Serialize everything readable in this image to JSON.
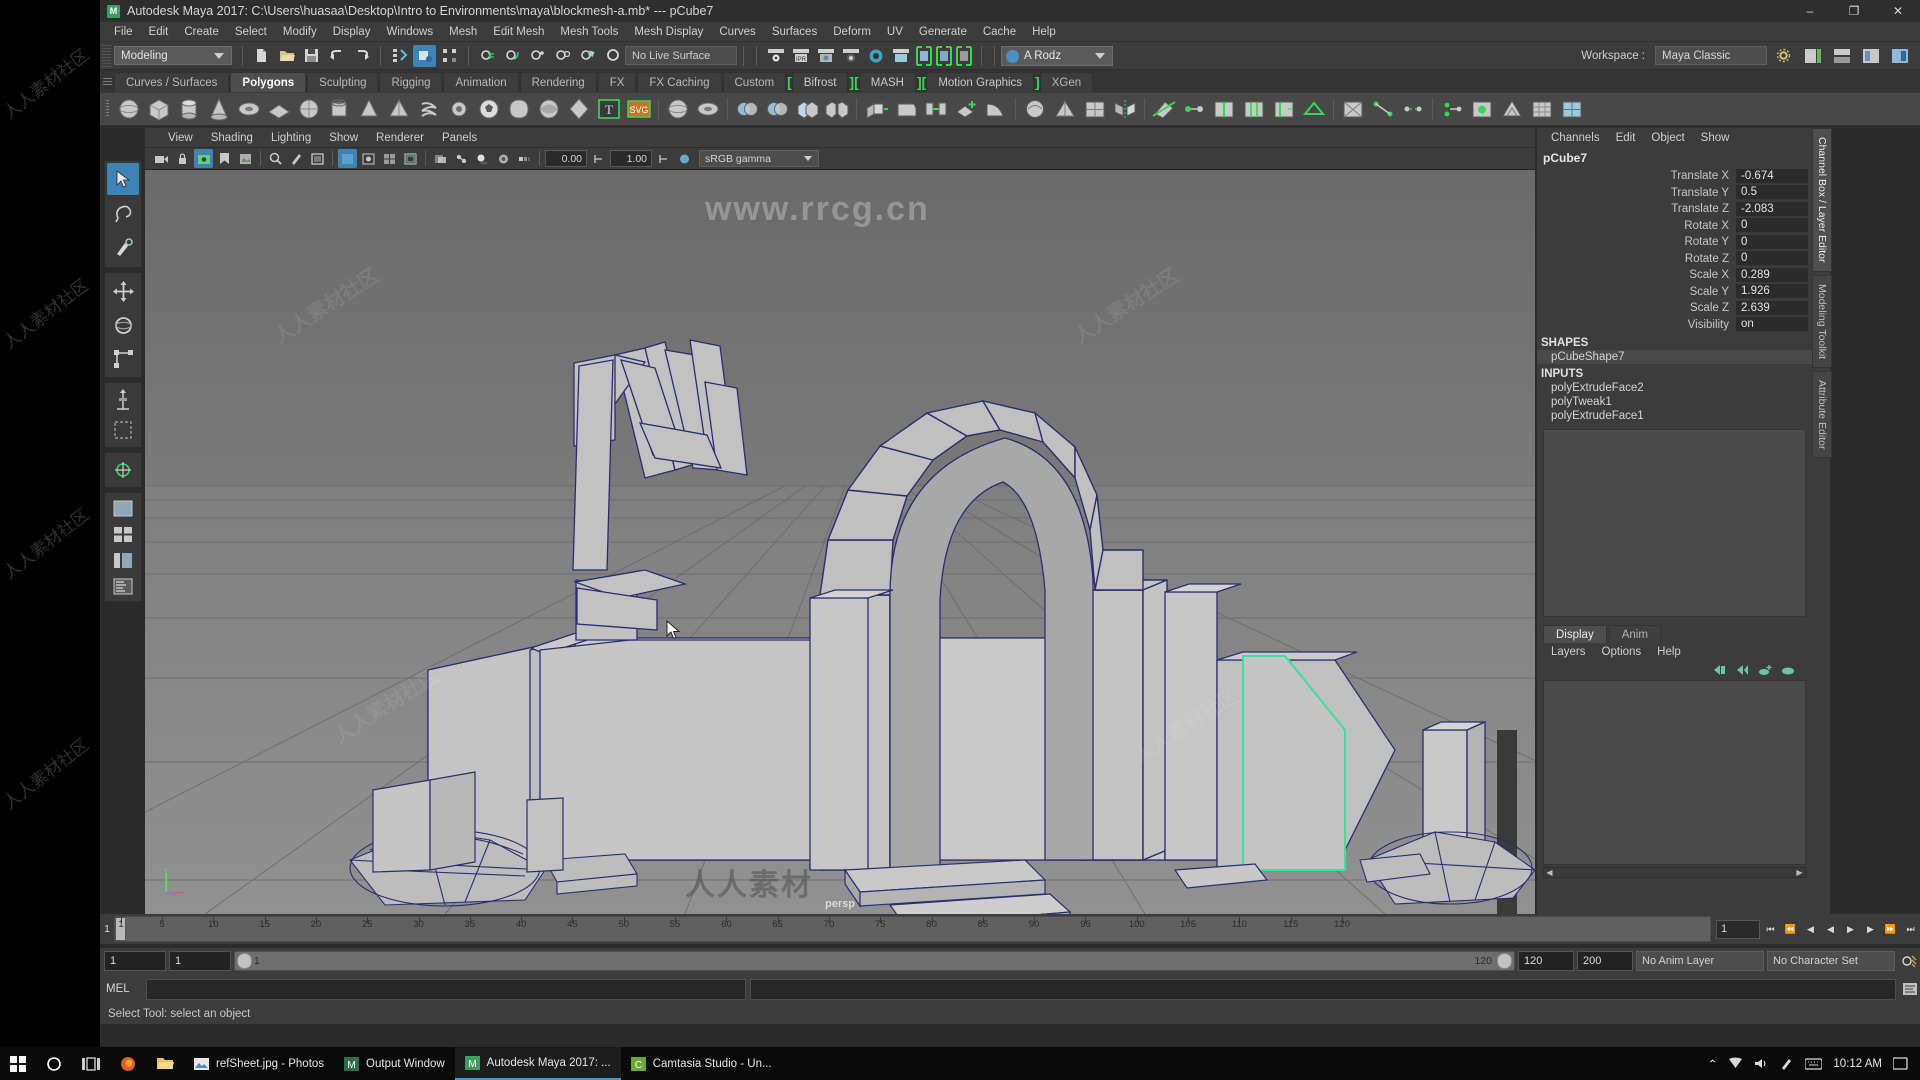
{
  "window": {
    "app_icon": "maya-logo-icon",
    "title": "Autodesk Maya 2017: C:\\Users\\huasaa\\Desktop\\Intro to Environments\\maya\\blockmesh-a.mb*  ---  pCube7",
    "minimize": "–",
    "maximize": "❐",
    "close": "✕"
  },
  "menubar": {
    "items": [
      "File",
      "Edit",
      "Create",
      "Select",
      "Modify",
      "Display",
      "Windows",
      "Mesh",
      "Edit Mesh",
      "Mesh Tools",
      "Mesh Display",
      "Curves",
      "Surfaces",
      "Deform",
      "UV",
      "Generate",
      "Cache",
      "Help"
    ]
  },
  "statusbar": {
    "mode": "Modeling",
    "live_surface": "No Live Surface",
    "num_a": "0.00",
    "num_b": "1.00",
    "gamma": "sRGB gamma",
    "user": "A Rodz",
    "workspace_label": "Workspace :",
    "workspace_value": "Maya Classic",
    "icons": [
      "new-scene-icon",
      "open-scene-icon",
      "save-scene-icon",
      "undo-icon",
      "redo-icon",
      "select-by-hierarchy-icon",
      "select-by-object-icon",
      "select-by-component-icon",
      "snap-to-grid-icon",
      "snap-to-curve-icon",
      "snap-to-point-icon",
      "snap-to-projected-center-icon",
      "snap-to-view-plane-icon",
      "make-live-icon",
      "render-current-frame-icon",
      "ipr-render-icon",
      "render-settings-icon",
      "hypershade-icon",
      "render-view-icon",
      "toggle-ui-icon"
    ]
  },
  "shelf": {
    "tabs": [
      "Curves / Surfaces",
      "Polygons",
      "Sculpting",
      "Rigging",
      "Animation",
      "Rendering",
      "FX",
      "FX Caching",
      "Custom",
      "Bifrost",
      "MASH",
      "Motion Graphics",
      "XGen"
    ],
    "active_tab": "Polygons",
    "bracketed_tabs": [
      "Bifrost",
      "MASH",
      "Motion Graphics"
    ],
    "icons": [
      "poly-sphere-icon",
      "poly-cube-icon",
      "poly-cylinder-icon",
      "poly-cone-icon",
      "poly-torus-icon",
      "poly-plane-icon",
      "poly-disc-icon",
      "poly-pipe-icon",
      "poly-prism-icon",
      "poly-pyramid-icon",
      "poly-helix-icon",
      "poly-gear-icon",
      "poly-soccer-ball-icon",
      "poly-super-ellipse-icon",
      "poly-spherical-harmonics-icon",
      "poly-ultra-shape-icon",
      "type-tool-icon",
      "svg-tool-icon",
      "sculpt-sphere-icon",
      "sculpt-torus-icon",
      "boolean-union-icon",
      "boolean-difference-icon",
      "combine-icon",
      "separate-icon",
      "extrude-icon",
      "bevel-icon",
      "bridge-icon",
      "append-polygon-icon",
      "wedge-face-icon",
      "smooth-icon",
      "triangulate-icon",
      "quadrangulate-icon",
      "mirror-geometry-icon",
      "multi-cut-icon",
      "target-weld-icon",
      "insert-edge-loop-icon",
      "offset-edge-loop-icon",
      "slide-edge-icon",
      "crease-tool-icon",
      "poke-face-icon",
      "connect-components-icon",
      "detach-component-icon",
      "merge-vertices-icon",
      "fill-hole-icon",
      "reduce-icon",
      "remesh-icon",
      "retopologize-icon"
    ]
  },
  "viewport": {
    "menus": [
      "View",
      "Shading",
      "Lighting",
      "Show",
      "Renderer",
      "Panels"
    ],
    "camera_label": "persp",
    "exposure": "0.00",
    "contrast": "1.00",
    "gamma": "sRGB gamma",
    "toolbar_icons": [
      "select-camera-icon",
      "lock-camera-icon",
      "camera-attributes-icon",
      "bookmark-icon",
      "image-plane-icon",
      "two-d-pan-zoom-icon",
      "grease-pencil-icon",
      "gate-mask-icon",
      "resolution-gate-icon",
      "film-gate-icon",
      "field-chart-icon",
      "safe-action-icon",
      "safe-title-icon",
      "xray-icon",
      "xray-joints-icon",
      "shadows-icon",
      "screen-space-ao-icon",
      "motion-blur-icon",
      "multisample-icon",
      "depth-of-field-icon",
      "color-management-icon"
    ]
  },
  "channelbox": {
    "menus": [
      "Channels",
      "Edit",
      "Object",
      "Show"
    ],
    "object_name": "pCube7",
    "attributes": [
      {
        "label": "Translate X",
        "value": "-0.674"
      },
      {
        "label": "Translate Y",
        "value": "0.5"
      },
      {
        "label": "Translate Z",
        "value": "-2.083"
      },
      {
        "label": "Rotate X",
        "value": "0"
      },
      {
        "label": "Rotate Y",
        "value": "0"
      },
      {
        "label": "Rotate Z",
        "value": "0"
      },
      {
        "label": "Scale X",
        "value": "0.289"
      },
      {
        "label": "Scale Y",
        "value": "1.926"
      },
      {
        "label": "Scale Z",
        "value": "2.639"
      },
      {
        "label": "Visibility",
        "value": "on"
      }
    ],
    "shapes_header": "SHAPES",
    "shapes": [
      "pCubeShape7"
    ],
    "inputs_header": "INPUTS",
    "inputs": [
      "polyExtrudeFace2",
      "polyTweak1",
      "polyExtrudeFace1"
    ]
  },
  "layer_editor": {
    "tabs": [
      "Display",
      "Anim"
    ],
    "active_tab": "Display",
    "menus": [
      "Layers",
      "Options",
      "Help"
    ],
    "buttons": [
      "new-layer-icon",
      "new-layer-from-selected-icon",
      "add-selected-icon",
      "remove-selected-icon"
    ]
  },
  "right_vtabs": {
    "items": [
      "Channel Box / Layer Editor",
      "Modeling Toolkit",
      "Attribute Editor"
    ],
    "active": "Channel Box / Layer Editor"
  },
  "timeline": {
    "ticks": [
      1,
      5,
      10,
      15,
      20,
      25,
      30,
      35,
      40,
      45,
      50,
      55,
      60,
      65,
      70,
      75,
      80,
      85,
      90,
      95,
      100,
      105,
      110,
      115,
      120
    ],
    "current_frame": "1",
    "playhead_frame": "1",
    "frame_field": "1",
    "transport_icons": [
      "go-to-start-icon",
      "step-back-key-icon",
      "step-back-frame-icon",
      "play-backwards-icon",
      "play-forwards-icon",
      "step-forward-frame-icon",
      "step-forward-key-icon",
      "go-to-end-icon"
    ]
  },
  "range": {
    "start": "1",
    "current": "1",
    "slider_min": "1",
    "slider_max": "120",
    "range_end": "120",
    "playback_end": "200",
    "anim_layer": "No Anim Layer",
    "character_set": "No Character Set",
    "anim_preferences_icon": "animation-preferences-icon"
  },
  "command_line": {
    "label": "MEL",
    "input_value": "",
    "output_value": "",
    "script_editor_icon": "script-editor-icon"
  },
  "help_line": {
    "text": "Select Tool: select an object"
  },
  "toolbox": {
    "tools": [
      "select-tool-icon",
      "lasso-select-tool-icon",
      "paint-select-tool-icon",
      "move-tool-icon",
      "rotate-tool-icon",
      "scale-tool-icon",
      "last-tool-icon",
      "show-manipulator-icon",
      "snap-align-icon",
      "single-perspective-view-icon",
      "four-view-layout-icon",
      "persp-outliner-layout-icon",
      "persp-graph-layout-icon",
      "hypershade-layout-icon",
      "outliner-layout-icon"
    ]
  },
  "taskbar": {
    "start_icon": "windows-start-icon",
    "search_icon": "cortana-search-icon",
    "taskview_icon": "task-view-icon",
    "items": [
      {
        "label": "refSheet.jpg - Photos",
        "icon": "photos-icon",
        "active": false
      },
      {
        "label": "Output Window",
        "icon": "maya-output-icon",
        "active": false
      },
      {
        "label": "Autodesk Maya 2017: ...",
        "icon": "maya-logo-icon",
        "active": true
      },
      {
        "label": "Camtasia Studio - Un...",
        "icon": "camtasia-icon",
        "active": false
      }
    ],
    "pinned": [
      {
        "icon": "firefox-icon"
      },
      {
        "icon": "file-explorer-icon"
      }
    ],
    "tray": [
      "show-hidden-icon",
      "network-icon",
      "volume-icon",
      "pen-icon",
      "keyboard-icon"
    ],
    "clock": "10:12 AM",
    "notification_icon": "action-center-icon"
  },
  "watermarks": {
    "top": "www.rrcg.cn",
    "bottom": "人人素材",
    "tile": "人人素材社区"
  },
  "colors": {
    "accent_green": "#35d94f",
    "selection_green": "#3ee0a0",
    "wireframe_blue": "#2a2e6e",
    "panel_bg": "#3c3c3c",
    "viewport_top": "#6d6d6d",
    "viewport_floor": "#8d8d8d",
    "highlight_blue": "#3d83b5"
  }
}
